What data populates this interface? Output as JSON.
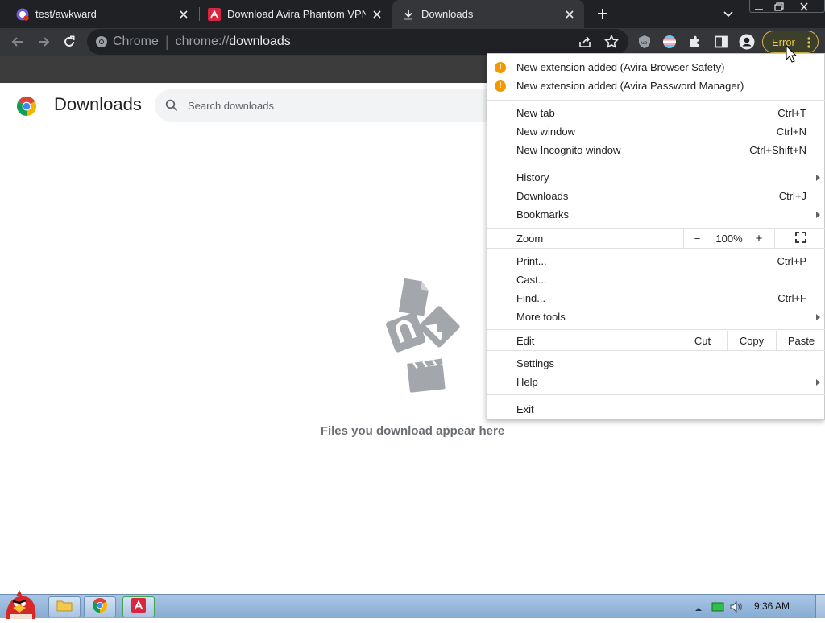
{
  "tabs": [
    {
      "title": "test/awkward",
      "active": false
    },
    {
      "title": "Download Avira Phantom VPN",
      "active": false
    },
    {
      "title": "Downloads",
      "active": true
    }
  ],
  "new_tab_symbol": "+",
  "omnibox": {
    "site_label": "Chrome",
    "url_scheme": "chrome://",
    "url_path": "downloads"
  },
  "error_button": {
    "label": "Error"
  },
  "page": {
    "title": "Downloads",
    "search_placeholder": "Search downloads",
    "empty_message": "Files you download appear here"
  },
  "menu": {
    "notifications": [
      "New extension added (Avira Browser Safety)",
      "New extension added (Avira Password Manager)"
    ],
    "new_tab": {
      "label": "New tab",
      "shortcut": "Ctrl+T"
    },
    "new_window": {
      "label": "New window",
      "shortcut": "Ctrl+N"
    },
    "new_incognito": {
      "label": "New Incognito window",
      "shortcut": "Ctrl+Shift+N"
    },
    "history": {
      "label": "History"
    },
    "downloads": {
      "label": "Downloads",
      "shortcut": "Ctrl+J"
    },
    "bookmarks": {
      "label": "Bookmarks"
    },
    "zoom": {
      "label": "Zoom",
      "minus": "−",
      "value": "100%",
      "plus": "+"
    },
    "print": {
      "label": "Print...",
      "shortcut": "Ctrl+P"
    },
    "cast": {
      "label": "Cast..."
    },
    "find": {
      "label": "Find...",
      "shortcut": "Ctrl+F"
    },
    "more_tools": {
      "label": "More tools"
    },
    "edit": {
      "label": "Edit",
      "cut": "Cut",
      "copy": "Copy",
      "paste": "Paste"
    },
    "settings": {
      "label": "Settings"
    },
    "help": {
      "label": "Help"
    },
    "exit": {
      "label": "Exit"
    }
  },
  "taskbar": {
    "clock": "9:36 AM"
  },
  "colors": {
    "accent_error": "#f2c94c",
    "warning": "#f29900",
    "chrome_dark": "#202124"
  }
}
